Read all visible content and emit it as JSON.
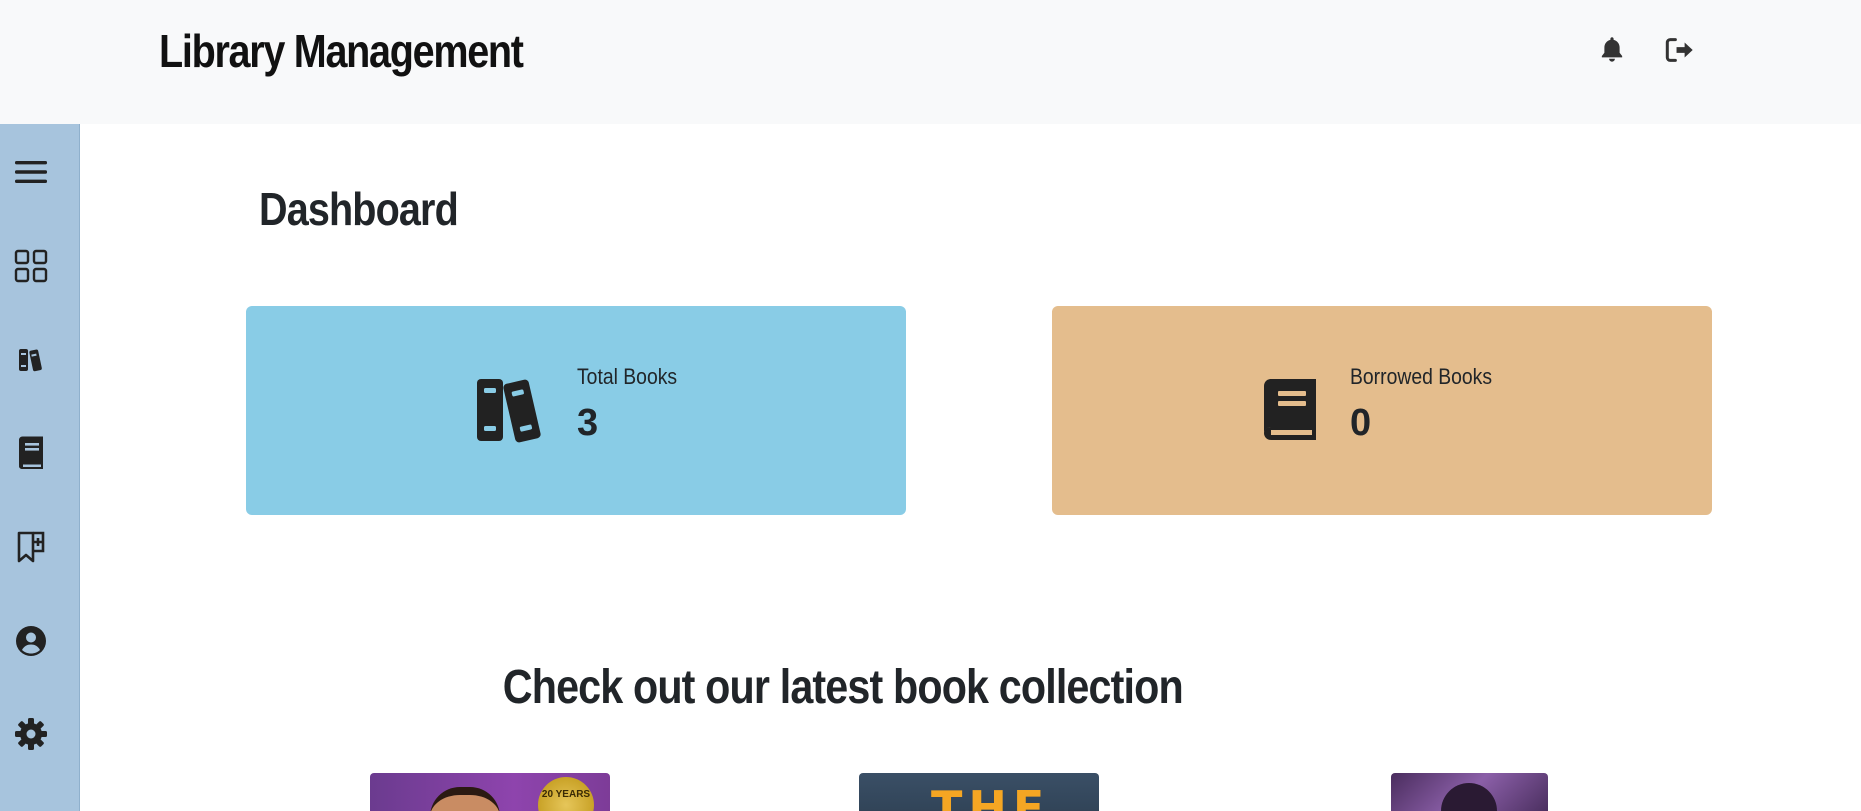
{
  "header": {
    "title": "Library Management",
    "icons": [
      "bell-icon",
      "logout-icon"
    ]
  },
  "sidebar": {
    "items": [
      {
        "name": "menu",
        "icon": "hamburger-menu-icon"
      },
      {
        "name": "dashboard",
        "icon": "grid-icon"
      },
      {
        "name": "books",
        "icon": "books-icon"
      },
      {
        "name": "borrowed-book",
        "icon": "book-icon"
      },
      {
        "name": "add-bookmark",
        "icon": "bookmark-plus-icon"
      },
      {
        "name": "profile",
        "icon": "user-circle-icon"
      },
      {
        "name": "settings",
        "icon": "gear-icon"
      }
    ]
  },
  "main": {
    "title": "Dashboard",
    "cards": [
      {
        "label": "Total Books",
        "value": "3",
        "icon": "books-icon",
        "color": "#89cce6"
      },
      {
        "label": "Borrowed Books",
        "value": "0",
        "icon": "book-icon",
        "color": "#e4bd8d"
      }
    ],
    "collection_heading": "Check out our latest book collection",
    "covers": [
      {
        "seal_text": "20 YEARS"
      },
      {
        "cover_text": "THE"
      },
      {}
    ]
  },
  "colors": {
    "topbar_bg": "#f8f9fa",
    "sidebar_bg": "#a7c4dd",
    "text": "#212529"
  }
}
